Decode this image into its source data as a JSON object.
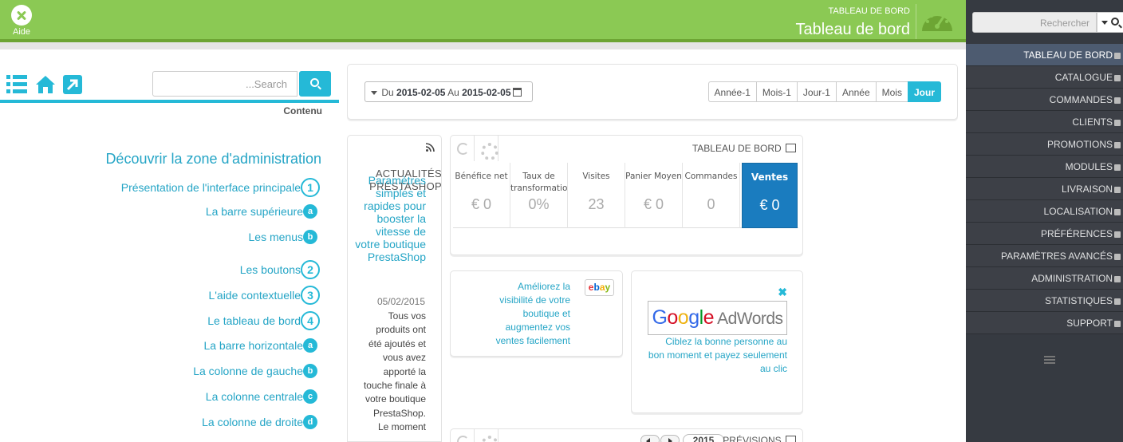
{
  "help": {
    "label": "Aide"
  },
  "header": {
    "breadcrumb": "TABLEAU DE BORD",
    "title": "Tableau de bord"
  },
  "sidebar": {
    "search_placeholder": "Rechercher",
    "items": [
      {
        "label": "TABLEAU DE BORD",
        "active": true
      },
      {
        "label": "CATALOGUE"
      },
      {
        "label": "COMMANDES"
      },
      {
        "label": "CLIENTS"
      },
      {
        "label": "PROMOTIONS"
      },
      {
        "label": "MODULES"
      },
      {
        "label": "LIVRAISON"
      },
      {
        "label": "LOCALISATION"
      },
      {
        "label": "PRÉFÉRENCES"
      },
      {
        "label": "PARAMÈTRES AVANCÉS"
      },
      {
        "label": "ADMINISTRATION"
      },
      {
        "label": "STATISTIQUES"
      },
      {
        "label": "SUPPORT"
      }
    ]
  },
  "guide": {
    "search_placeholder": "...Search",
    "contenu": "Contenu",
    "title": "Découvrir la zone d'administration",
    "items": [
      {
        "label": "Présentation de l'interface principale",
        "badge": "1"
      },
      {
        "label": "La barre supérieure",
        "badge": "a"
      },
      {
        "label": "Les menus",
        "badge": "b"
      },
      {
        "label": "Les boutons",
        "badge": "2"
      },
      {
        "label": "L'aide contextuelle",
        "badge": "3"
      },
      {
        "label": "Le tableau de bord",
        "badge": "4"
      },
      {
        "label": "La barre horizontale",
        "badge": "a"
      },
      {
        "label": "La colonne de gauche",
        "badge": "b"
      },
      {
        "label": "La colonne centrale",
        "badge": "c"
      },
      {
        "label": "La colonne de droite",
        "badge": "d"
      }
    ]
  },
  "toolbar": {
    "date_du": "Du",
    "date_from": "2015-02-05",
    "date_au": "Au",
    "date_to": "2015-02-05",
    "periods": [
      "Année-1",
      "Mois-1",
      "Jour-1",
      "Année",
      "Mois",
      "Jour"
    ],
    "active_period": "Jour"
  },
  "news": {
    "heading": "ACTUALITÉS PRESTASHOP",
    "article_title": "Paramètres simples et rapides pour booster la vitesse de votre boutique PrestaShop",
    "date": "05/02/2015",
    "body": "Tous vos produits ont été ajoutés et vous avez apporté la touche finale à votre boutique PrestaShop. Le moment"
  },
  "kpi": {
    "title": "TABLEAU DE BORD",
    "cells": [
      {
        "label": "Bénéfice net",
        "value": "€ 0"
      },
      {
        "label": "Taux de transformation",
        "value": "0%"
      },
      {
        "label": "Visites",
        "value": "23"
      },
      {
        "label": "Panier Moyen",
        "value": "€ 0"
      },
      {
        "label": "Commandes",
        "value": "0"
      },
      {
        "label": "Ventes",
        "value": "€ 0",
        "active": true
      }
    ]
  },
  "ebay": {
    "text": "Améliorez la visibilité de votre boutique et augmentez vos ventes facilement"
  },
  "adwords": {
    "brand": "AdWords",
    "text": "Ciblez la bonne personne au bon moment et payez seulement au clic"
  },
  "forecast": {
    "year": "2015",
    "title": "PRÉVISIONS"
  },
  "colors": {
    "green": "#8bc954",
    "accent": "#25b9d7",
    "menu_bg": "#363a41",
    "kpi_active": "#1a7cbf"
  }
}
